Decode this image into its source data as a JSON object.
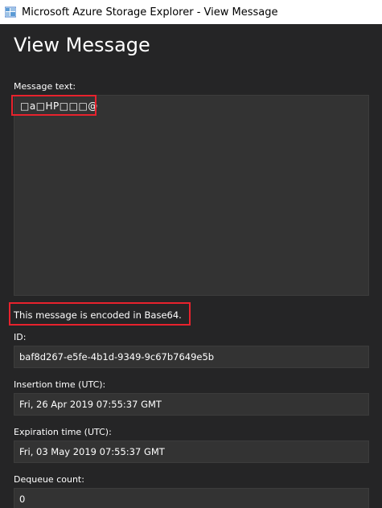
{
  "window": {
    "title": "Microsoft Azure Storage Explorer - View Message",
    "icon": "azure-storage-explorer-icon"
  },
  "page": {
    "title": "View Message"
  },
  "message": {
    "label": "Message text:",
    "value": "□a□HP□□□@",
    "encoding_note": "This message is encoded in Base64."
  },
  "fields": {
    "id": {
      "label": "ID:",
      "value": "baf8d267-e5fe-4b1d-9349-9c67b7649e5b"
    },
    "insertion_time": {
      "label": "Insertion time (UTC):",
      "value": "Fri, 26 Apr 2019 07:55:37 GMT"
    },
    "expiration_time": {
      "label": "Expiration time (UTC):",
      "value": "Fri, 03 May 2019 07:55:37 GMT"
    },
    "dequeue_count": {
      "label": "Dequeue count:",
      "value": "0"
    }
  },
  "colors": {
    "background": "#252526",
    "field_background": "#333333",
    "highlight": "#e8222d",
    "text": "#ffffff"
  }
}
